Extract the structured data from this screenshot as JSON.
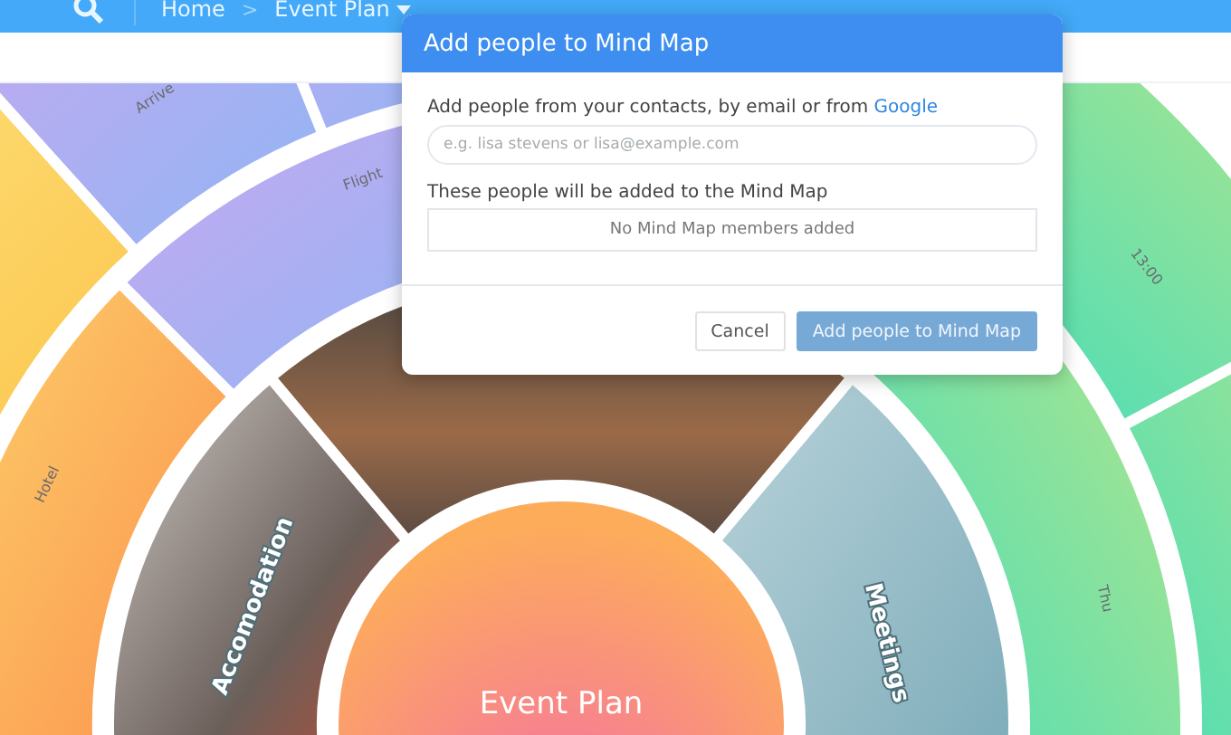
{
  "header": {
    "breadcrumbs": [
      {
        "label": "Home",
        "dropdown": false
      },
      {
        "label": "Event Plan",
        "dropdown": true
      }
    ],
    "separator": ">"
  },
  "mind_map": {
    "center": "Event Plan",
    "branches": [
      {
        "label": "Accomodation",
        "children": [
          {
            "label": "Hotel"
          }
        ]
      },
      {
        "children": [
          {
            "label": "Flight",
            "children": [
              {
                "label": "Arrive"
              }
            ]
          }
        ]
      },
      {
        "label": "Meetings",
        "children": [
          {
            "label": "Thu",
            "children": [
              {
                "label": "13:00"
              }
            ]
          }
        ]
      }
    ]
  },
  "dialog": {
    "title": "Add people to Mind Map",
    "prompt": "Add people from your contacts, by email or from",
    "prompt_link": "Google",
    "search": {
      "placeholder": "e.g. lisa stevens or lisa@example.com"
    },
    "members_label": "These people will be added to the Mind Map",
    "members_empty": "No Mind Map members added",
    "buttons": [
      {
        "label": "Cancel",
        "kind": "secondary",
        "disabled": false
      },
      {
        "label": "Add people to Mind Map",
        "kind": "primary",
        "disabled": true
      }
    ]
  }
}
